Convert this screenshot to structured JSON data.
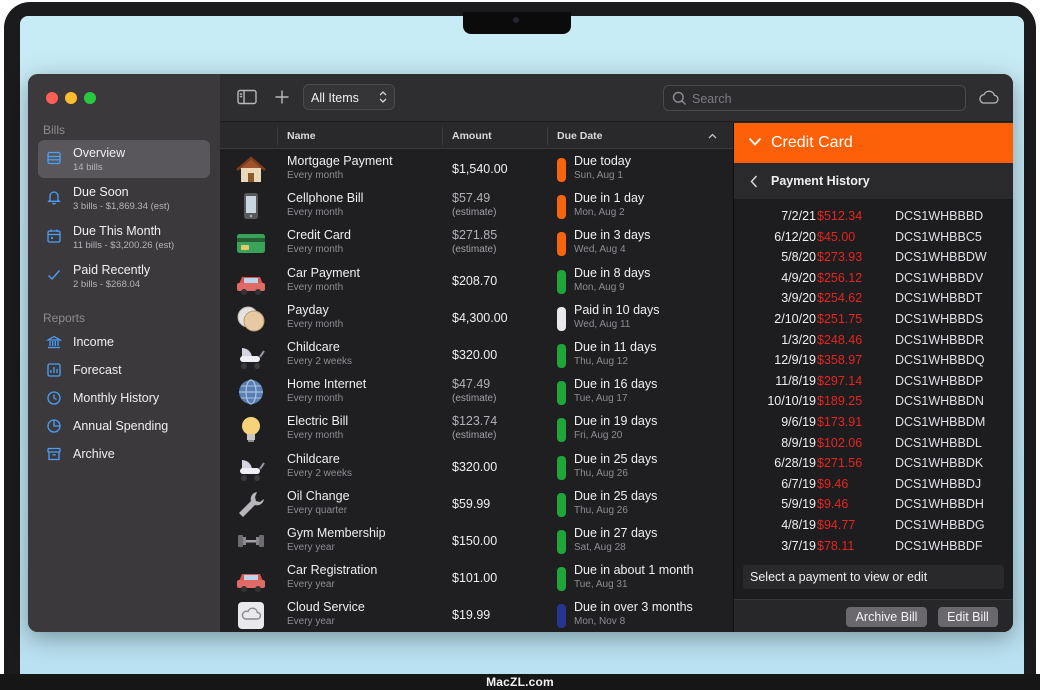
{
  "brand": "MacZL.com",
  "sidebar": {
    "bills_section": "Bills",
    "reports_section": "Reports",
    "bills": [
      {
        "label": "Overview",
        "sub": "14 bills",
        "icon": "list-icon"
      },
      {
        "label": "Due Soon",
        "sub": "3 bills - $1,869.34 (est)",
        "icon": "bell-icon"
      },
      {
        "label": "Due This Month",
        "sub": "11 bills - $3,200.26 (est)",
        "icon": "calendar-icon"
      },
      {
        "label": "Paid Recently",
        "sub": "2 bills - $268.04",
        "icon": "checkmark-icon"
      }
    ],
    "reports": [
      {
        "label": "Income",
        "icon": "bank-icon"
      },
      {
        "label": "Forecast",
        "icon": "chart-icon"
      },
      {
        "label": "Monthly History",
        "icon": "clock-icon"
      },
      {
        "label": "Annual Spending",
        "icon": "pie-icon"
      },
      {
        "label": "Archive",
        "icon": "archive-icon"
      }
    ]
  },
  "toolbar": {
    "filter_value": "All Items",
    "search_placeholder": "Search",
    "icons": [
      "sidebar-toggle-icon",
      "add-icon",
      "cloud-icon"
    ]
  },
  "list": {
    "headers": {
      "name": "Name",
      "amount": "Amount",
      "due": "Due Date"
    },
    "rows": [
      {
        "name": "Mortgage Payment",
        "freq": "Every month",
        "amount": "$1,540.00",
        "estimate": "",
        "due": "Due today",
        "date": "Sun, Aug 1",
        "status": "#f5650d",
        "icon": "house-icon"
      },
      {
        "name": "Cellphone Bill",
        "freq": "Every month",
        "amount": "$57.49",
        "estimate": "(estimate)",
        "due": "Due in 1 day",
        "date": "Mon, Aug 2",
        "status": "#f5650d",
        "icon": "phone-icon"
      },
      {
        "name": "Credit Card",
        "freq": "Every month",
        "amount": "$271.85",
        "estimate": "(estimate)",
        "due": "Due in 3 days",
        "date": "Wed, Aug 4",
        "status": "#f5650d",
        "icon": "credit-card-icon"
      },
      {
        "name": "Car Payment",
        "freq": "Every month",
        "amount": "$208.70",
        "estimate": "",
        "due": "Due in 8 days",
        "date": "Mon, Aug 9",
        "status": "#1fa53a",
        "icon": "car-icon"
      },
      {
        "name": "Payday",
        "freq": "Every month",
        "amount": "$4,300.00",
        "estimate": "",
        "due": "Paid in 10 days",
        "date": "Wed, Aug 11",
        "status": "#e9e8ec",
        "icon": "coins-icon"
      },
      {
        "name": "Childcare",
        "freq": "Every 2 weeks",
        "amount": "$320.00",
        "estimate": "",
        "due": "Due in 11 days",
        "date": "Thu, Aug 12",
        "status": "#1fa53a",
        "icon": "stroller-icon"
      },
      {
        "name": "Home Internet",
        "freq": "Every month",
        "amount": "$47.49",
        "estimate": "(estimate)",
        "due": "Due in 16 days",
        "date": "Tue, Aug 17",
        "status": "#1fa53a",
        "icon": "globe-icon"
      },
      {
        "name": "Electric Bill",
        "freq": "Every month",
        "amount": "$123.74",
        "estimate": "(estimate)",
        "due": "Due in 19 days",
        "date": "Fri, Aug 20",
        "status": "#1fa53a",
        "icon": "lightbulb-icon"
      },
      {
        "name": "Childcare",
        "freq": "Every 2 weeks",
        "amount": "$320.00",
        "estimate": "",
        "due": "Due in 25 days",
        "date": "Thu, Aug 26",
        "status": "#1fa53a",
        "icon": "stroller-icon"
      },
      {
        "name": "Oil Change",
        "freq": "Every quarter",
        "amount": "$59.99",
        "estimate": "",
        "due": "Due in 25 days",
        "date": "Thu, Aug 26",
        "status": "#1fa53a",
        "icon": "wrench-icon"
      },
      {
        "name": "Gym Membership",
        "freq": "Every year",
        "amount": "$150.00",
        "estimate": "",
        "due": "Due in 27 days",
        "date": "Sat, Aug 28",
        "status": "#1fa53a",
        "icon": "dumbbell-icon"
      },
      {
        "name": "Car Registration",
        "freq": "Every year",
        "amount": "$101.00",
        "estimate": "",
        "due": "Due in about 1 month",
        "date": "Tue, Aug 31",
        "status": "#1fa53a",
        "icon": "car-icon"
      },
      {
        "name": "Cloud Service",
        "freq": "Every year",
        "amount": "$19.99",
        "estimate": "",
        "due": "Due in over 3 months",
        "date": "Mon, Nov 8",
        "status": "#26358f",
        "icon": "cloud-service-icon"
      }
    ]
  },
  "detail": {
    "title": "Credit Card",
    "subtitle": "Payment History",
    "payments": [
      {
        "date": "7/2/21",
        "amount": "$512.34",
        "code": "DCS1WHBBBD"
      },
      {
        "date": "6/12/20",
        "amount": "$45.00",
        "code": "DCS1WHBBC5"
      },
      {
        "date": "5/8/20",
        "amount": "$273.93",
        "code": "DCS1WHBBDW"
      },
      {
        "date": "4/9/20",
        "amount": "$256.12",
        "code": "DCS1WHBBDV"
      },
      {
        "date": "3/9/20",
        "amount": "$254.62",
        "code": "DCS1WHBBDT"
      },
      {
        "date": "2/10/20",
        "amount": "$251.75",
        "code": "DCS1WHBBDS"
      },
      {
        "date": "1/3/20",
        "amount": "$248.46",
        "code": "DCS1WHBBDR"
      },
      {
        "date": "12/9/19",
        "amount": "$358.97",
        "code": "DCS1WHBBDQ"
      },
      {
        "date": "11/8/19",
        "amount": "$297.14",
        "code": "DCS1WHBBDP"
      },
      {
        "date": "10/10/19",
        "amount": "$189.25",
        "code": "DCS1WHBBDN"
      },
      {
        "date": "9/6/19",
        "amount": "$173.91",
        "code": "DCS1WHBBDM"
      },
      {
        "date": "8/9/19",
        "amount": "$102.06",
        "code": "DCS1WHBBDL"
      },
      {
        "date": "6/28/19",
        "amount": "$271.56",
        "code": "DCS1WHBBDK"
      },
      {
        "date": "6/7/19",
        "amount": "$9.46",
        "code": "DCS1WHBBDJ"
      },
      {
        "date": "5/9/19",
        "amount": "$9.46",
        "code": "DCS1WHBBDH"
      },
      {
        "date": "4/8/19",
        "amount": "$94.77",
        "code": "DCS1WHBBDG"
      },
      {
        "date": "3/7/19",
        "amount": "$78.11",
        "code": "DCS1WHBBDF"
      }
    ],
    "select_hint": "Select a payment to view or edit",
    "archive_button": "Archive Bill",
    "edit_button": "Edit Bill"
  },
  "colors": {
    "accent": "#fb6008",
    "link": "#4d9ff8",
    "payment_amount": "#e5261f"
  }
}
